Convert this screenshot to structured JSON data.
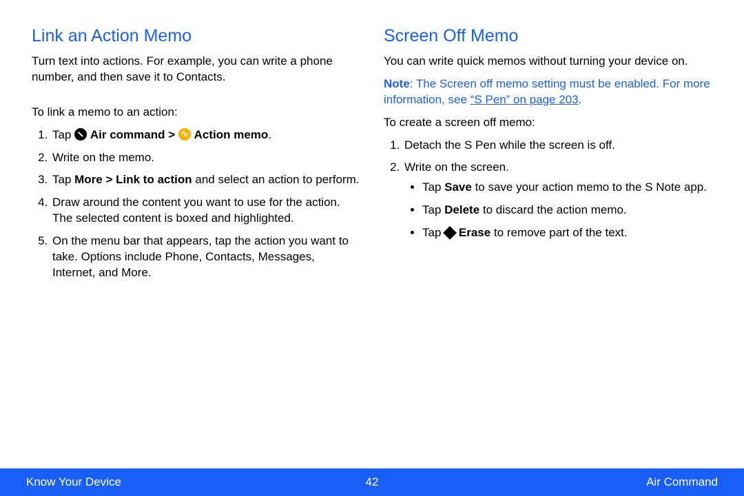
{
  "left": {
    "heading": "Link an Action Memo",
    "intro": "Turn text into actions. For example, you can write a phone number, and then save it to Contacts.",
    "lead": "To link a memo to an action:",
    "step1_tap": "Tap ",
    "step1_aircommand": "Air command > ",
    "step1_actionmemo": "Action memo",
    "step1_end": ".",
    "step2": "Write on the memo.",
    "step3_a": "Tap ",
    "step3_b": "More > Link to action",
    "step3_c": " and select an action to perform.",
    "step4": "Draw around the content you want to use for the action. The selected content is boxed and highlighted.",
    "step5": "On the menu bar that appears, tap the action you want to take. Options include Phone, Contacts, Messages, Internet, and More."
  },
  "right": {
    "heading": "Screen Off Memo",
    "intro": "You can write quick memos without turning your device on.",
    "note_label": "Note",
    "note_text": ": The Screen off memo setting must be enabled. For more information, see ",
    "note_link": "“S Pen” on page 203",
    "note_end": ".",
    "lead": "To create a screen off memo:",
    "step1": "Detach the S Pen while the screen is off.",
    "step2": "Write on the screen.",
    "b1_a": "Tap ",
    "b1_b": "Save",
    "b1_c": " to save your action memo to the S Note app.",
    "b2_a": "Tap ",
    "b2_b": "Delete",
    "b2_c": " to discard the action memo.",
    "b3_a": "Tap ",
    "b3_b": "Erase",
    "b3_c": " to remove part of the text."
  },
  "footer": {
    "left": "Know Your Device",
    "page": "42",
    "right": "Air Command"
  }
}
